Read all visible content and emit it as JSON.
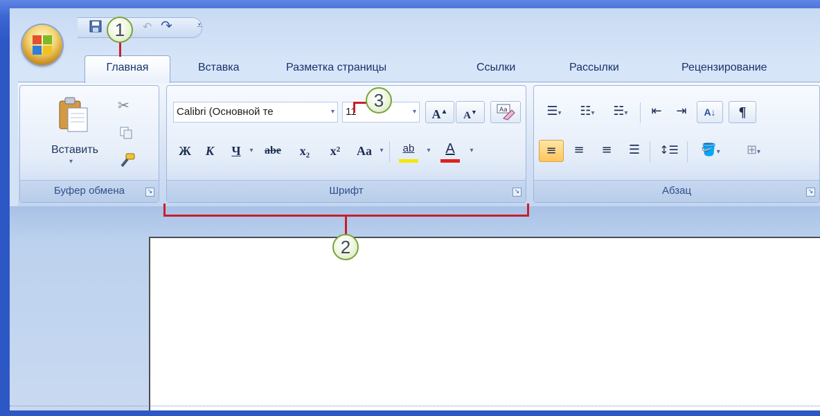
{
  "window": {
    "theme": "office-2007-blue"
  },
  "quick_access": {
    "icons": [
      "office-orb-icon",
      "save-icon",
      "undo-icon",
      "redo-icon",
      "customize-icon"
    ]
  },
  "tabs": [
    {
      "label": "Главная",
      "active": true
    },
    {
      "label": "Вставка"
    },
    {
      "label": "Разметка страницы"
    },
    {
      "label": "Ссылки"
    },
    {
      "label": "Рассылки"
    },
    {
      "label": "Рецензирование"
    }
  ],
  "clipboard": {
    "paste_label": "Вставить",
    "group_label": "Буфер обмена"
  },
  "font": {
    "name": "Calibri (Основной те",
    "size": "11",
    "group_label": "Шрифт",
    "bold": "Ж",
    "italic": "К",
    "underline": "Ч",
    "strike": "abe",
    "subscript": "x₂",
    "superscript": "x²",
    "change_case": "Aa",
    "highlight": "ab",
    "font_color": "A",
    "grow": "A",
    "shrink": "A"
  },
  "paragraph": {
    "group_label": "Абзац",
    "sort": "А↓",
    "pilcrow": "¶"
  },
  "callouts": [
    "1",
    "2",
    "3"
  ],
  "colors": {
    "accent_red": "#c71f29",
    "highlight_yellow": "#f4e800",
    "font_color_red": "#e0201c"
  }
}
